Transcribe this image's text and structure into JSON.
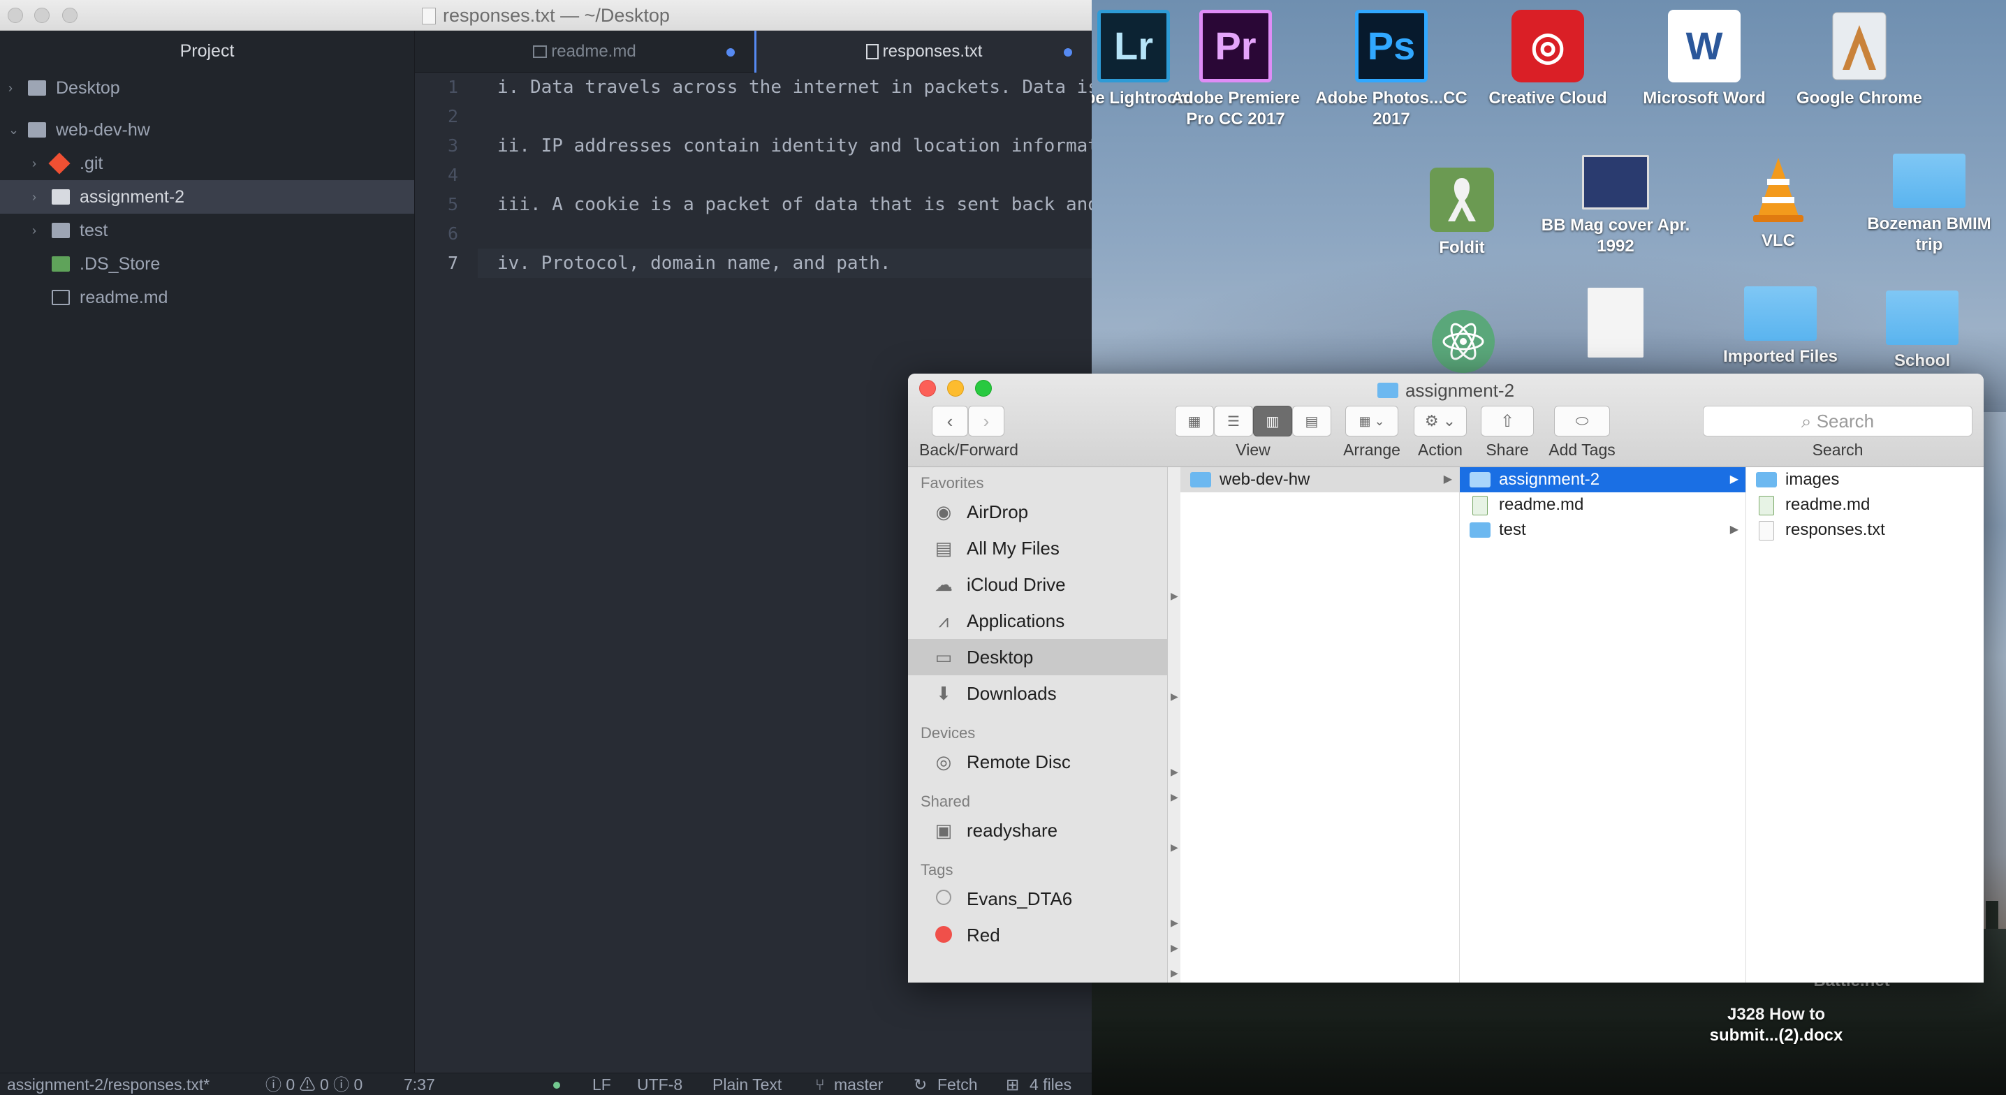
{
  "atom": {
    "window_title": "responses.txt — ~/Desktop",
    "tree_header": "Project",
    "tree": [
      {
        "label": "Desktop",
        "chevron": "›"
      },
      {
        "label": "web-dev-hw",
        "chevron": "⌄"
      },
      {
        "label": ".git",
        "chevron": "›"
      },
      {
        "label": "assignment-2",
        "chevron": "›"
      },
      {
        "label": "test",
        "chevron": "›"
      },
      {
        "label": ".DS_Store"
      },
      {
        "label": "readme.md"
      }
    ],
    "tabs": [
      {
        "label": "readme.md"
      },
      {
        "label": "responses.txt"
      }
    ],
    "line_numbers": [
      "1",
      "2",
      "3",
      "4",
      "5",
      "6",
      "7"
    ],
    "lines": [
      "i. Data travels across the internet in packets. Data is broken",
      "",
      "ii. IP addresses contain identity and location information",
      "",
      "iii. A cookie is a packet of data that is sent back and forth",
      "",
      "iv. Protocol, domain name, and path."
    ],
    "status": {
      "file": "assignment-2/responses.txt*",
      "diagnostics": "ⓘ 0 ⚠ 0 ⓘ 0",
      "cursor": "7:37",
      "line_ending": "LF",
      "encoding": "UTF-8",
      "grammar": "Plain Text",
      "branch": "master",
      "fetch": "Fetch",
      "files": "4 files"
    }
  },
  "desktop": {
    "icons": [
      {
        "label": "obe Lightroom",
        "glyph": "Lr"
      },
      {
        "label": "Adobe Premiere Pro CC 2017",
        "glyph": "Pr"
      },
      {
        "label": "Adobe Photos...CC 2017",
        "glyph": "Ps"
      },
      {
        "label": "Creative Cloud",
        "glyph": "◎"
      },
      {
        "label": "Microsoft Word",
        "glyph": "W"
      },
      {
        "label": "Google Chrome",
        "glyph": "△"
      },
      {
        "label": "Foldit",
        "glyph": "🎗"
      },
      {
        "label": "BB Mag cover Apr. 1992",
        "glyph": ""
      },
      {
        "label": "VLC",
        "glyph": "▲"
      },
      {
        "label": "Bozeman BMIM trip",
        "glyph": ""
      },
      {
        "label": "Imported Files",
        "glyph": ""
      },
      {
        "label": "School",
        "glyph": ""
      },
      {
        "label": "J328 How to submit...(2).docx",
        "glyph": ""
      },
      {
        "label": "Battle.net",
        "glyph": ""
      }
    ]
  },
  "finder": {
    "title": "assignment-2",
    "toolbar": {
      "back_forward": "Back/Forward",
      "view": "View",
      "arrange": "Arrange",
      "action": "Action",
      "share": "Share",
      "add_tags": "Add Tags",
      "search_placeholder": "Search",
      "search_label": "Search"
    },
    "sidebar": {
      "favorites_header": "Favorites",
      "favorites": [
        "AirDrop",
        "All My Files",
        "iCloud Drive",
        "Applications",
        "Desktop",
        "Downloads"
      ],
      "devices_header": "Devices",
      "devices": [
        "Remote Disc"
      ],
      "shared_header": "Shared",
      "shared": [
        "readyshare"
      ],
      "tags_header": "Tags",
      "tags": [
        {
          "label": "Evans_DTA6",
          "color": "#e3e3e3"
        },
        {
          "label": "Red",
          "color": "#f0504a"
        }
      ]
    },
    "columns": [
      [
        {
          "label": "web-dev-hw",
          "kind": "folder"
        }
      ],
      [
        {
          "label": "assignment-2",
          "kind": "folder"
        },
        {
          "label": "readme.md",
          "kind": "md"
        },
        {
          "label": "test",
          "kind": "folder"
        }
      ],
      [
        {
          "label": "images",
          "kind": "folder"
        },
        {
          "label": "readme.md",
          "kind": "md"
        },
        {
          "label": "responses.txt",
          "kind": "txt"
        }
      ]
    ]
  },
  "colors": {
    "editor_bg": "#282c34",
    "tree_bg": "#21252b",
    "accent_blue": "#568af2",
    "finder_selection": "#1a6fe4",
    "git_branch_color": "#f05033"
  }
}
